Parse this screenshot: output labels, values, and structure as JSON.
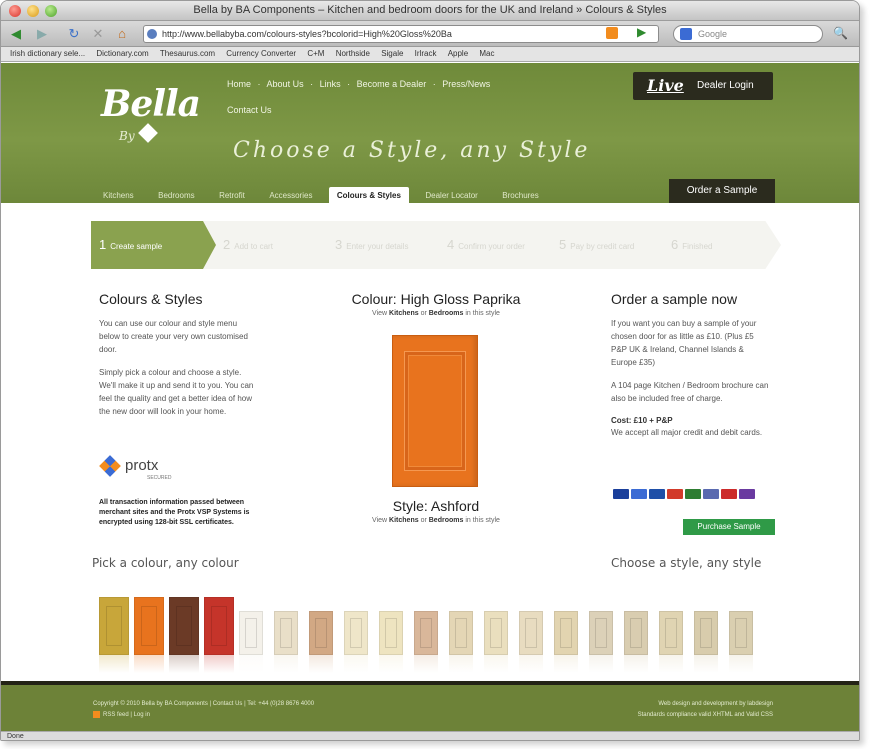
{
  "window": {
    "title": "Bella by BA Components – Kitchen and bedroom doors for the UK and Ireland » Colours & Styles"
  },
  "toolbar": {
    "url": "http://www.bellabyba.com/colours-styles?bcolorid=High%20Gloss%20Ba",
    "search_placeholder": "Google",
    "icons": [
      "back-icon",
      "forward-icon",
      "reload-icon",
      "stop-icon",
      "home-icon",
      "rss-icon",
      "go-icon",
      "search-icon"
    ]
  },
  "bookmarks": [
    "Irish dictionary sele...",
    "Dictionary.com",
    "Thesaurus.com",
    "Currency Converter",
    "C+M",
    "Northside",
    "Sigale",
    "Irlrack",
    "Apple",
    "Mac"
  ],
  "header": {
    "logo": "Bella",
    "logo_sub": "By",
    "topnav": [
      "Home",
      "·",
      "About Us",
      "·",
      "Links",
      "·",
      "Become a Dealer",
      "·",
      "Press/News"
    ],
    "contact": "Contact Us",
    "tagline": "Choose a Style, any Style",
    "live_label": "Live",
    "dealer_login": "Dealer Login",
    "order_sample": "Order a Sample"
  },
  "mainnav": [
    {
      "label": "Kitchens",
      "active": false
    },
    {
      "label": "Bedrooms",
      "active": false
    },
    {
      "label": "Retrofit",
      "active": false
    },
    {
      "label": "Accessories",
      "active": false
    },
    {
      "label": "Colours & Styles",
      "active": true
    },
    {
      "label": "Dealer Locator",
      "active": false
    },
    {
      "label": "Brochures",
      "active": false
    }
  ],
  "steps": [
    {
      "num": "1",
      "label": "Create sample",
      "active": true
    },
    {
      "num": "2",
      "label": "Add to cart",
      "active": false
    },
    {
      "num": "3",
      "label": "Enter your details",
      "active": false
    },
    {
      "num": "4",
      "label": "Confirm your order",
      "active": false
    },
    {
      "num": "5",
      "label": "Pay by credit card",
      "active": false
    },
    {
      "num": "6",
      "label": "Finished",
      "active": false
    }
  ],
  "left": {
    "title": "Colours & Styles",
    "p1": "You can use our colour and style menu below to create your very own customised door.",
    "p2": "Simply pick a colour and choose a style. We'll make it up and send it to you. You can feel the quality and get a better idea of how the new door will look in your home.",
    "protx": "protx",
    "protx_sub": "SECURED",
    "secure_note": "All transaction information passed between merchant sites and the Protx VSP Systems is encrypted using 128-bit SSL certificates."
  },
  "center": {
    "colour_title": "Colour: High Gloss Paprika",
    "view_prefix": "View",
    "kitchens": "Kitchens",
    "or": "or",
    "bedrooms": "Bedrooms",
    "view_suffix": "in this style",
    "door_color": "#e8731e",
    "style_title": "Style: Ashford"
  },
  "right": {
    "title": "Order a sample now",
    "p1": "If you want you can buy a sample of your chosen door for as little as £10. (Plus £5 P&P UK & Ireland, Channel Islands & Europe £35)",
    "p2": "A 104 page Kitchen / Bedroom brochure can also be included free of charge.",
    "cost": "Cost: £10 + P&P",
    "cost_note": "We accept all major credit and debit cards.",
    "purchase": "Purchase Sample",
    "cards": [
      "#1a3f9b",
      "#3b6bd4",
      "#1e4fa8",
      "#d23a2a",
      "#2e7d32",
      "#5a6ab0",
      "#cc2a2a",
      "#6a3aa0"
    ]
  },
  "pick_label": "Pick a colour, any colour",
  "choose_label": "Choose a style, any style",
  "swatches": [
    "#c8a63a",
    "#e8731e",
    "#6b3a26",
    "#c5342a",
    "#f4f1ea",
    "#e9dfc8",
    "#d2a884",
    "#efe6c9",
    "#eee4c0",
    "#d9b79a",
    "#e4d6b5",
    "#eadfbe",
    "#e8dcc0",
    "#e2d4b0",
    "#dcd1b8",
    "#d9cdb0",
    "#e0d4b2",
    "#d8ccac",
    "#dacfb0"
  ],
  "footer": {
    "copyright": "Copyright © 2010 Bella by BA Components",
    "contact": "Contact Us",
    "tel": "Tel: +44 (0)28 8676 4000",
    "rss": "RSS feed",
    "login": "Log in",
    "credit_line1": "Web design and development by labdesign",
    "credit_line2": "Standards compliance valid XHTML and Valid CSS"
  },
  "status": "Done"
}
